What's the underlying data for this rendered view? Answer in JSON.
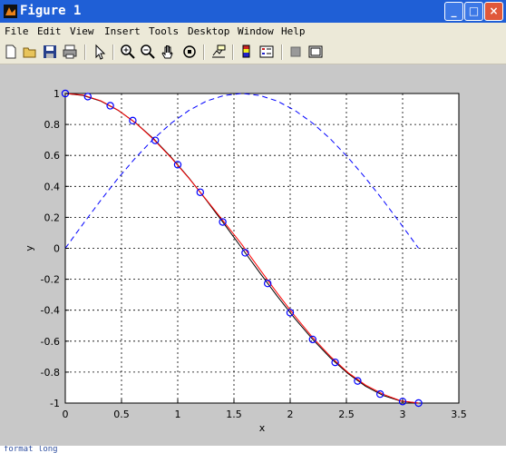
{
  "window": {
    "title": "Figure 1",
    "minimize_glyph": "_",
    "maximize_glyph": "□",
    "close_glyph": "×"
  },
  "menu": [
    "File",
    "Edit",
    "View",
    "Insert",
    "Tools",
    "Desktop",
    "Window",
    "Help"
  ],
  "toolbar_icons": [
    "new-figure-icon",
    "open-file-icon",
    "save-icon",
    "print-icon",
    "edit-plot-arrow-icon",
    "zoom-in-icon",
    "zoom-out-icon",
    "pan-hand-icon",
    "rotate-3d-icon",
    "data-cursor-icon",
    "colorbar-icon",
    "legend-icon",
    "hide-plot-tools-icon",
    "show-plot-tools-icon"
  ],
  "colors": {
    "titlebar": "#1f5fd6",
    "figure_bg": "#c8c8c8",
    "axes_bg": "#ffffff"
  },
  "status_text": "format long",
  "chart_data": {
    "type": "line",
    "xlabel": "x",
    "ylabel": "y",
    "xlim": [
      0,
      3.5
    ],
    "ylim": [
      -1,
      1
    ],
    "grid": true,
    "xticks": [
      "0",
      "0.5",
      "1",
      "1.5",
      "2",
      "2.5",
      "3",
      "3.5"
    ],
    "yticks": [
      "1",
      "0.8",
      "0.6",
      "0.4",
      "0.2",
      "0",
      "-0.2",
      "-0.4",
      "-0.6",
      "-0.8",
      "-1"
    ],
    "series": [
      {
        "style": "dashed",
        "color": "#0000ff",
        "x": [
          0,
          0.1571,
          0.3142,
          0.4712,
          0.6283,
          0.7854,
          0.9425,
          1.0996,
          1.2566,
          1.4137,
          1.5708,
          1.7279,
          1.885,
          2.042,
          2.1991,
          2.3562,
          2.5133,
          2.6704,
          2.8274,
          2.9845,
          3.1416
        ],
        "y": [
          0,
          0.1564,
          0.309,
          0.454,
          0.5878,
          0.7071,
          0.809,
          0.891,
          0.9511,
          0.9877,
          1,
          0.9877,
          0.9511,
          0.891,
          0.809,
          0.7071,
          0.5878,
          0.454,
          0.309,
          0.1564,
          0
        ]
      },
      {
        "style": "solid",
        "color": "#000000",
        "x": [
          0,
          0.1571,
          0.3142,
          0.4712,
          0.6283,
          0.7854,
          0.9425,
          1.0996,
          1.2566,
          1.4137,
          1.5708,
          1.7279,
          1.885,
          2.042,
          2.1991,
          2.3562,
          2.5133,
          2.6704,
          2.8274,
          2.9845,
          3.1416
        ],
        "y": [
          1,
          0.9877,
          0.9511,
          0.891,
          0.809,
          0.7071,
          0.5878,
          0.454,
          0.309,
          0.1564,
          0,
          -0.1564,
          -0.309,
          -0.454,
          -0.5878,
          -0.7071,
          -0.809,
          -0.891,
          -0.9511,
          -0.9877,
          -1
        ]
      },
      {
        "style": "solid",
        "color": "#ff0000",
        "x": [
          0,
          0.1571,
          0.3142,
          0.4712,
          0.6283,
          0.7854,
          0.9425,
          1.0996,
          1.2566,
          1.4137,
          1.5708,
          1.7279,
          1.885,
          2.042,
          2.1991,
          2.3562,
          2.5133,
          2.6704,
          2.8274,
          2.9845,
          3.1416
        ],
        "y": [
          1.0,
          0.9901,
          0.9537,
          0.8923,
          0.8081,
          0.7041,
          0.5841,
          0.4521,
          0.3121,
          0.1681,
          0.0241,
          -0.1341,
          -0.2891,
          -0.4381,
          -0.5761,
          -0.6981,
          -0.8021,
          -0.8841,
          -0.9431,
          -0.9861,
          -1.0
        ]
      },
      {
        "style": "markers",
        "marker": "circle",
        "color": "#0000ff",
        "x": [
          0,
          0.2,
          0.4,
          0.6,
          0.8,
          1.0,
          1.2,
          1.4,
          1.6,
          1.8,
          2.0,
          2.2,
          2.4,
          2.6,
          2.8,
          3.0,
          3.1416
        ],
        "y": [
          1,
          0.98,
          0.921,
          0.825,
          0.697,
          0.54,
          0.362,
          0.17,
          -0.029,
          -0.227,
          -0.416,
          -0.589,
          -0.737,
          -0.857,
          -0.942,
          -0.99,
          -1
        ]
      }
    ]
  }
}
